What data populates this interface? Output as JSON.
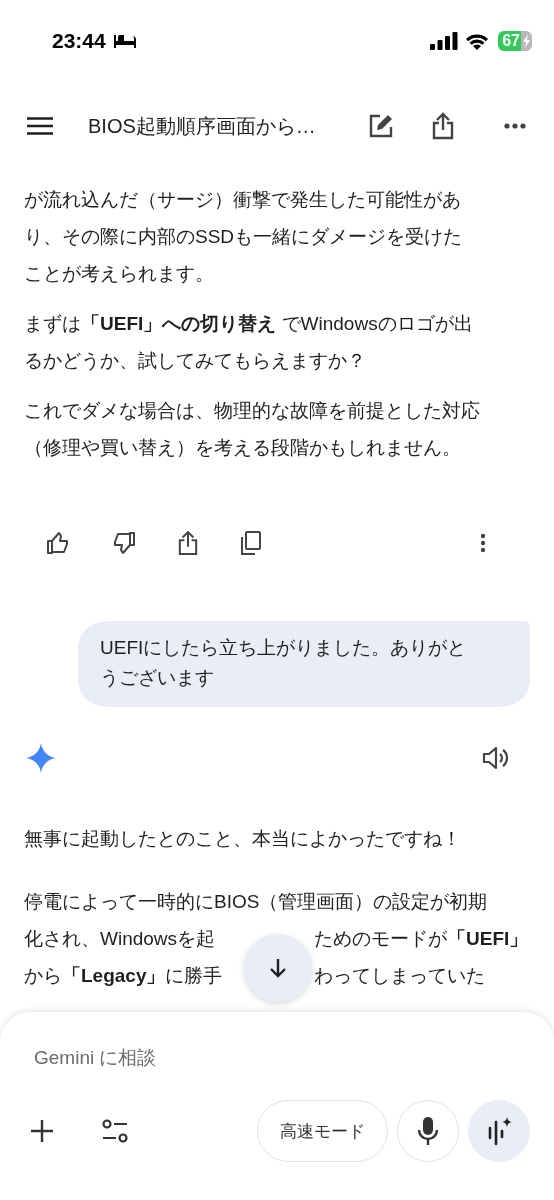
{
  "status_bar": {
    "time": "23:44",
    "battery": "67"
  },
  "header": {
    "title": "BIOS起動順序画面から…"
  },
  "previous_response": {
    "paragraphs": [
      {
        "lines": [
          "が流れ込んだ（サージ）衝撃で発生した可能性があ",
          "り、その際に内部のSSDも一緒にダメージを受けた",
          "ことが考えられます。"
        ]
      },
      {
        "lines": [
          "まずは**「UEFI」への切り替え** でWindowsのロゴが出",
          "るかどうか、試してみてもらえますか？"
        ]
      },
      {
        "lines": [
          "これでダメな場合は、物理的な故障を前提とした対応",
          "（修理や買い替え）を考える段階かもしれません。"
        ]
      }
    ]
  },
  "user_message": {
    "lines": [
      "UEFIにしたら立ち上がりました。ありがと",
      "うございます"
    ]
  },
  "response": {
    "paragraphs": [
      {
        "lines": [
          [
            "無事に起動したとのこと、本当によかったですね！"
          ]
        ]
      },
      {
        "lines": [
          [
            "停電によって一時的にBIOS（管理画面）の設定が初期"
          ],
          [
            "化され、Windowsを起",
            "ためのモードが**「UEFI」**"
          ],
          [
            "から**「Legacy」**に勝手",
            "わってしまっていた"
          ]
        ]
      }
    ]
  },
  "composer": {
    "placeholder": "Gemini に相談",
    "mode_button": "高速モード"
  }
}
